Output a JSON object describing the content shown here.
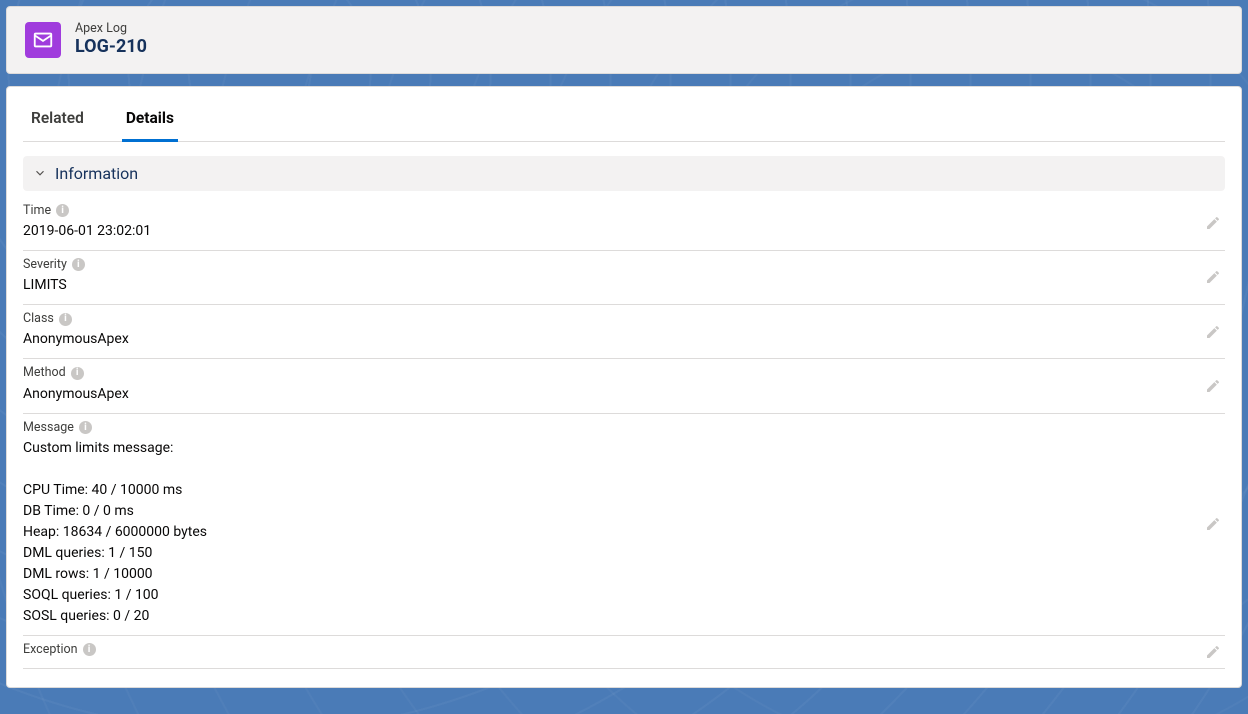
{
  "header": {
    "eyebrow": "Apex Log",
    "title": "LOG-210"
  },
  "tabs": [
    {
      "id": "related",
      "label": "Related",
      "active": false
    },
    {
      "id": "details",
      "label": "Details",
      "active": true
    }
  ],
  "section": {
    "title": "Information"
  },
  "fields": {
    "time": {
      "label": "Time",
      "value": "2019-06-01 23:02:01"
    },
    "severity": {
      "label": "Severity",
      "value": "LIMITS"
    },
    "class": {
      "label": "Class",
      "value": "AnonymousApex"
    },
    "method": {
      "label": "Method",
      "value": "AnonymousApex"
    },
    "message": {
      "label": "Message",
      "value": "Custom limits message:\n\nCPU Time: 40 / 10000 ms\nDB Time: 0 / 0 ms\nHeap: 18634 / 6000000 bytes\nDML queries: 1 / 150\nDML rows: 1 / 10000\nSOQL queries: 1 / 100\nSOSL queries: 0 / 20"
    },
    "exception": {
      "label": "Exception",
      "value": ""
    }
  },
  "field_order": [
    "time",
    "severity",
    "class",
    "method",
    "message",
    "exception"
  ]
}
